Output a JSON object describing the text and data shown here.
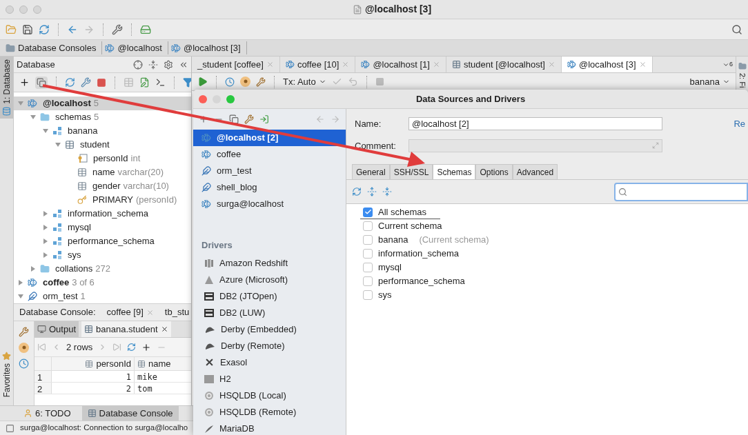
{
  "window": {
    "title": "@localhost [3]"
  },
  "breadcrumbs": [
    "Database Consoles",
    "@localhost",
    "@localhost [3]"
  ],
  "left_stripe": [
    {
      "label": "1: Database",
      "selected": true
    },
    {
      "label": "Favorites",
      "selected": false
    }
  ],
  "database_panel": {
    "title": "Database",
    "tree": [
      {
        "label": "@localhost",
        "detail": "5",
        "kind": "connection",
        "bold": true,
        "expanded": true,
        "selected": true,
        "children": [
          {
            "label": "schemas",
            "detail": "5",
            "kind": "folder",
            "expanded": true,
            "selected": false,
            "children": [
              {
                "label": "banana",
                "kind": "schema",
                "expanded": true,
                "selected": false,
                "children": [
                  {
                    "label": "student",
                    "kind": "table",
                    "expanded": true,
                    "selected": false,
                    "children": [
                      {
                        "label": "personId",
                        "detail": "int",
                        "kind": "key-column",
                        "selected": false
                      },
                      {
                        "label": "name",
                        "detail": "varchar(20)",
                        "kind": "column",
                        "selected": false
                      },
                      {
                        "label": "gender",
                        "detail": "varchar(10)",
                        "kind": "column",
                        "selected": false
                      },
                      {
                        "label": "PRIMARY",
                        "detail": "(personId)",
                        "kind": "key",
                        "selected": false
                      }
                    ]
                  }
                ]
              },
              {
                "label": "information_schema",
                "kind": "schema",
                "expanded": false,
                "selected": false
              },
              {
                "label": "mysql",
                "kind": "schema",
                "expanded": false,
                "selected": false
              },
              {
                "label": "performance_schema",
                "kind": "schema",
                "expanded": false,
                "selected": false
              },
              {
                "label": "sys",
                "kind": "schema",
                "expanded": false,
                "selected": false
              }
            ]
          },
          {
            "label": "collations",
            "detail": "272",
            "kind": "folder",
            "expanded": false,
            "selected": false
          }
        ]
      },
      {
        "label": "coffee",
        "detail": "3 of 6",
        "kind": "connection",
        "bold": true,
        "expanded": false,
        "selected": false
      },
      {
        "label": "orm_test",
        "detail": "1",
        "kind": "sqlite",
        "expanded": true,
        "selected": false
      }
    ]
  },
  "console_panel": {
    "label": "Database Console:",
    "tabs": [
      "coffee [9]",
      "tb_stu"
    ],
    "result_tabs": [
      {
        "label": "Output",
        "selected": false
      },
      {
        "label": "banana.student",
        "selected": true
      }
    ],
    "rows_label": "2 rows",
    "table": {
      "columns": [
        "personId",
        "name"
      ],
      "rows": [
        {
          "index": "1",
          "cells": [
            "1",
            "mike"
          ]
        },
        {
          "index": "2",
          "cells": [
            "2",
            "tom"
          ]
        }
      ]
    }
  },
  "editor_tabs": [
    {
      "label": "_student [coffee]",
      "selected": false
    },
    {
      "label": "coffee [10]",
      "kind": "connection",
      "selected": false
    },
    {
      "label": "@localhost [1]",
      "kind": "connection",
      "selected": false
    },
    {
      "label": "student [@localhost]",
      "kind": "table",
      "selected": false
    },
    {
      "label": "@localhost [3]",
      "kind": "connection",
      "selected": true
    }
  ],
  "tab_count": "6",
  "editor_toolbar": {
    "transaction": "Tx: Auto",
    "schema": "banana"
  },
  "right_stripe": "2: Fi",
  "bottom_tools": [
    {
      "label": "6: TODO",
      "selected": false
    },
    {
      "label": "Database Console",
      "selected": true
    }
  ],
  "status_bar": "surga@localhost: Connection to surga@localho",
  "dialog": {
    "title": "Data Sources and Drivers",
    "sources": [
      {
        "label": "@localhost [2]",
        "kind": "mysql",
        "selected": true
      },
      {
        "label": "coffee",
        "kind": "mysql",
        "selected": false
      },
      {
        "label": "orm_test",
        "kind": "sqlite",
        "selected": false
      },
      {
        "label": "shell_blog",
        "kind": "sqlite",
        "selected": false
      },
      {
        "label": "surga@localhost",
        "kind": "mysql",
        "selected": false
      }
    ],
    "drivers_heading": "Drivers",
    "drivers": [
      {
        "label": "Amazon Redshift",
        "kind": "redshift"
      },
      {
        "label": "Azure (Microsoft)",
        "kind": "azure"
      },
      {
        "label": "DB2 (JTOpen)",
        "kind": "db2"
      },
      {
        "label": "DB2 (LUW)",
        "kind": "db2"
      },
      {
        "label": "Derby (Embedded)",
        "kind": "derby"
      },
      {
        "label": "Derby (Remote)",
        "kind": "derby"
      },
      {
        "label": "Exasol",
        "kind": "exasol"
      },
      {
        "label": "H2",
        "kind": "h2"
      },
      {
        "label": "HSQLDB (Local)",
        "kind": "hsqldb"
      },
      {
        "label": "HSQLDB (Remote)",
        "kind": "hsqldb"
      },
      {
        "label": "MariaDB",
        "kind": "mariadb"
      }
    ],
    "name_label": "Name:",
    "name_value": "@localhost [2]",
    "comment_label": "Comment:",
    "link": "Re",
    "tabs": [
      {
        "label": "General",
        "selected": false
      },
      {
        "label": "SSH/SSL",
        "selected": false
      },
      {
        "label": "Schemas",
        "selected": true
      },
      {
        "label": "Options",
        "selected": false
      },
      {
        "label": "Advanced",
        "selected": false
      }
    ],
    "schemas": [
      {
        "label": "All schemas",
        "checked": true,
        "focused": true
      },
      {
        "label": "Current schema",
        "checked": false,
        "focused": false
      },
      {
        "label": "banana",
        "note": "(Current schema)",
        "checked": false,
        "focused": false
      },
      {
        "label": "information_schema",
        "checked": false,
        "focused": false
      },
      {
        "label": "mysql",
        "checked": false,
        "focused": false
      },
      {
        "label": "performance_schema",
        "checked": false,
        "focused": false
      },
      {
        "label": "sys",
        "checked": false,
        "focused": false
      }
    ]
  }
}
